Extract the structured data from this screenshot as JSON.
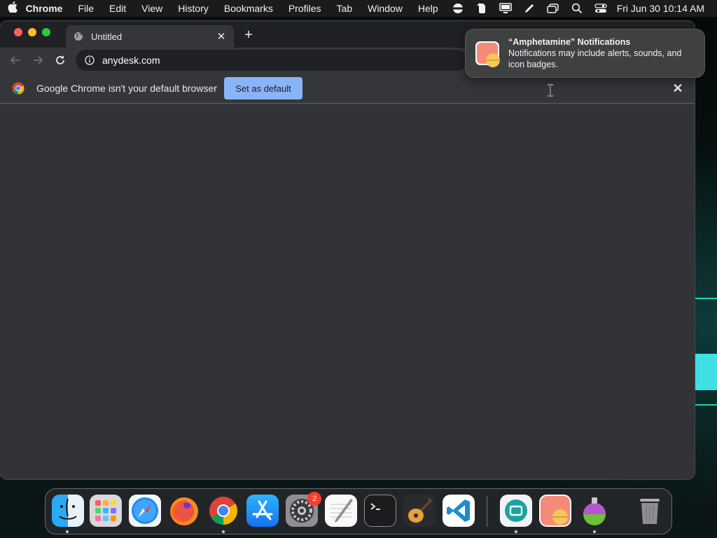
{
  "menubar": {
    "app_name": "Chrome",
    "menus": [
      "File",
      "Edit",
      "View",
      "History",
      "Bookmarks",
      "Profiles",
      "Tab",
      "Window",
      "Help"
    ],
    "clock": "Fri Jun 30  10:14 AM",
    "status_icons": [
      "eclipse-icon",
      "evernote-icon",
      "display-icon",
      "pen-icon",
      "window-icon",
      "search-icon",
      "control-center-icon"
    ]
  },
  "browser": {
    "tab_title": "Untitled",
    "address": "anydesk.com",
    "infobar_message": "Google Chrome isn't your default browser",
    "set_default_label": "Set as default"
  },
  "notification": {
    "title": "“Amphetamine” Notifications",
    "body": "Notifications may include alerts, sounds, and icon badges."
  },
  "dock": {
    "apps": [
      "Finder",
      "Launchpad",
      "Safari",
      "Firefox",
      "Chrome",
      "App Store",
      "System Settings",
      "TextEdit",
      "Terminal",
      "GarageBand",
      "Visual Studio Code",
      "Screen Sharing",
      "Amphetamine",
      "Gradient",
      "Trash"
    ],
    "settings_badge": "2"
  },
  "colors": {
    "accent": "#8ab4f8",
    "window_bg": "#323336",
    "badge": "#ff3b30"
  }
}
